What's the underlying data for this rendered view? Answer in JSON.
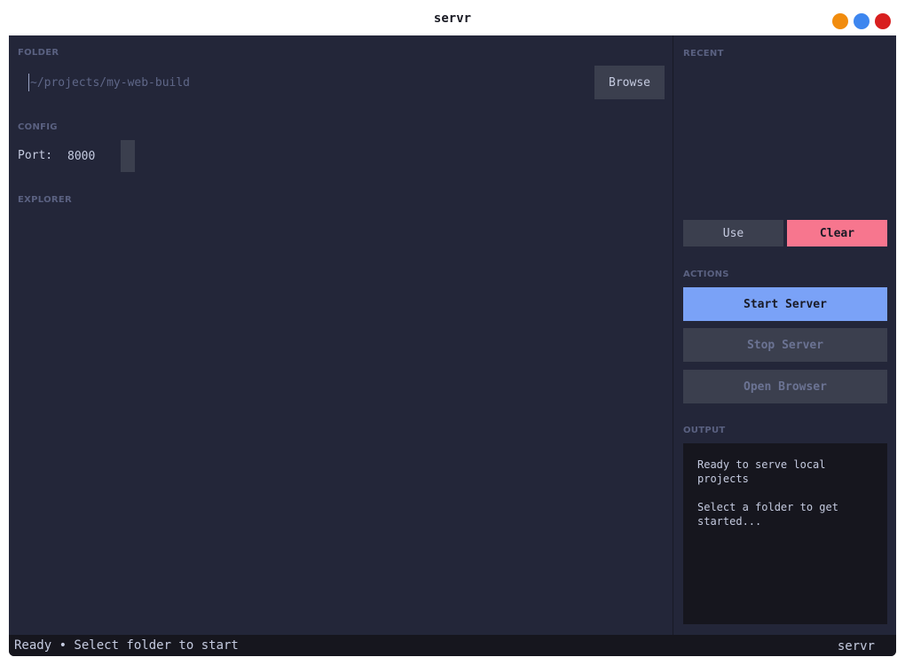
{
  "window": {
    "title": "servr",
    "controls": {
      "minimize_color": "#f18c0e",
      "maximize_color": "#3d86ef",
      "close_color": "#d81f1f"
    }
  },
  "main": {
    "folder": {
      "label": "FOLDER",
      "placeholder": "~/projects/my-web-build",
      "value": "",
      "browse_label": "Browse"
    },
    "config": {
      "label": "CONFIG",
      "port_label": "Port:",
      "port_value": "8000"
    },
    "explorer": {
      "label": "EXPLORER"
    }
  },
  "sidebar": {
    "recent": {
      "label": "RECENT",
      "use_label": "Use",
      "clear_label": "Clear"
    },
    "actions": {
      "label": "ACTIONS",
      "start_label": "Start Server",
      "stop_label": "Stop Server",
      "open_label": "Open Browser"
    },
    "output": {
      "label": "OUTPUT",
      "lines": [
        "Ready to serve local projects",
        "Select a folder to get started..."
      ]
    }
  },
  "statusbar": {
    "status": "Ready • Select folder to start",
    "app_name": "servr"
  },
  "colors": {
    "background": "#232639",
    "accent": "#7aa2f7",
    "danger": "#f7768e",
    "button": "#3b3f4e",
    "output_bg": "#16161e"
  }
}
